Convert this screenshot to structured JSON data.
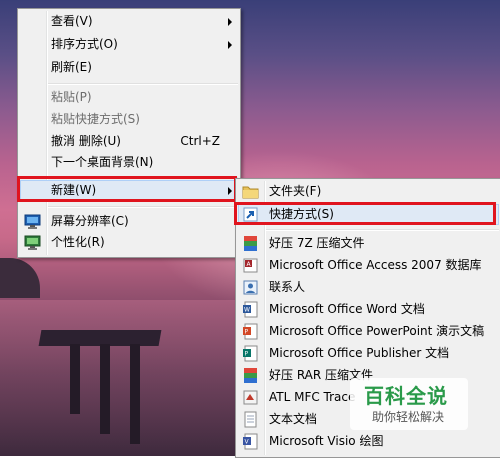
{
  "context_menu": {
    "items": [
      {
        "label": "查看(V)",
        "submenu": true
      },
      {
        "label": "排序方式(O)",
        "submenu": true
      },
      {
        "label": "刷新(E)"
      },
      {
        "label": "粘贴(P)",
        "disabled": true
      },
      {
        "label": "粘贴快捷方式(S)",
        "disabled": true
      },
      {
        "label": "撤消 删除(U)",
        "shortcut": "Ctrl+Z"
      },
      {
        "label": "下一个桌面背景(N)"
      },
      {
        "label": "新建(W)",
        "submenu": true,
        "highlighted": true
      },
      {
        "label": "屏幕分辨率(C)",
        "icon": "monitor-icon"
      },
      {
        "label": "个性化(R)",
        "icon": "personalize-icon"
      }
    ]
  },
  "new_submenu": {
    "items": [
      {
        "label": "文件夹(F)",
        "icon": "folder-icon"
      },
      {
        "label": "快捷方式(S)",
        "icon": "shortcut-icon",
        "highlighted": true
      },
      {
        "label": "好压 7Z 压缩文件",
        "icon": "7z-archive-icon"
      },
      {
        "label": "Microsoft Office Access 2007 数据库",
        "icon": "access-database-icon"
      },
      {
        "label": "联系人",
        "icon": "contact-icon"
      },
      {
        "label": "Microsoft Office Word 文档",
        "icon": "word-document-icon"
      },
      {
        "label": "Microsoft Office PowerPoint 演示文稿",
        "icon": "powerpoint-icon"
      },
      {
        "label": "Microsoft Office Publisher 文档",
        "icon": "publisher-icon"
      },
      {
        "label": "好压 RAR 压缩文件",
        "icon": "rar-archive-icon"
      },
      {
        "label": "ATL MFC Trace",
        "icon": "atl-mfc-trace-icon"
      },
      {
        "label": "文本文档",
        "icon": "text-document-icon"
      },
      {
        "label": "Microsoft Visio 绘图",
        "icon": "visio-icon"
      }
    ]
  },
  "watermark": {
    "title": "百科全说",
    "subtitle": "助你轻松解决"
  },
  "colors": {
    "highlight_border": "#e0141e",
    "menu_bg": "#f0f0f0",
    "hover_bg": "#dfe9f5"
  }
}
